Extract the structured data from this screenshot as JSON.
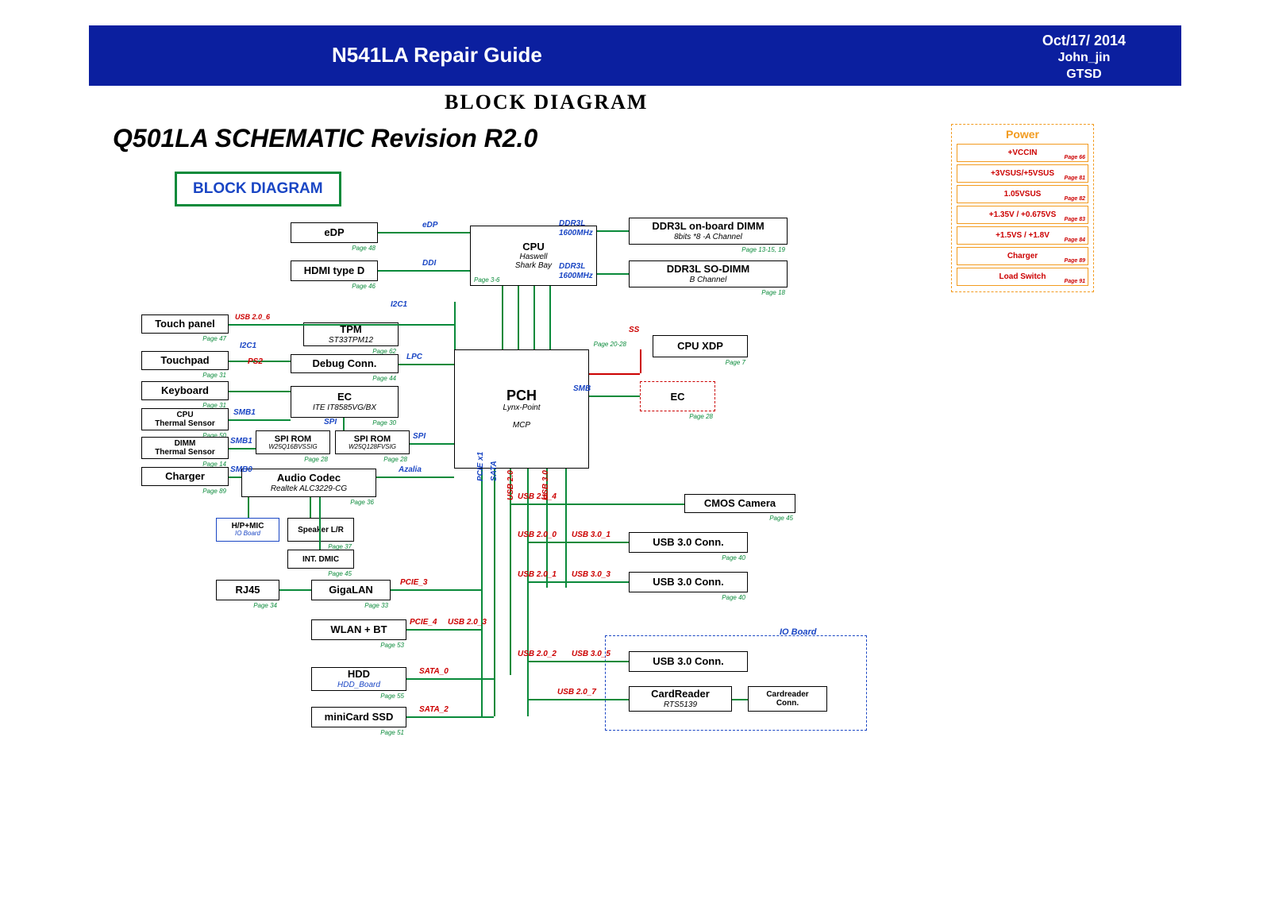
{
  "header": {
    "title": "N541LA Repair Guide",
    "date": "Oct/17/ 2014",
    "author": "John_jin",
    "org": "GTSD"
  },
  "section_title": "BLOCK DIAGRAM",
  "schematic_title": "Q501LA SCHEMATIC Revision R2.0",
  "bd_label": "BLOCK DIAGRAM",
  "blocks": {
    "edp": {
      "t": "eDP",
      "p": "Page 48"
    },
    "hdmi": {
      "t": "HDMI type D",
      "p": "Page 46"
    },
    "cpu": {
      "t": "CPU",
      "s": "Haswell\nShark Bay",
      "p": "Page 3-6"
    },
    "ddr_on": {
      "t": "DDR3L on-board DIMM",
      "s": "8bits *8 -A Channel",
      "p": "Page 13-15, 19"
    },
    "ddr_so": {
      "t": "DDR3L SO-DIMM",
      "s": "B Channel",
      "p": "Page 18"
    },
    "touchpanel": {
      "t": "Touch panel",
      "p": "Page 47"
    },
    "tpm": {
      "t": "TPM",
      "s": "ST33TPM12",
      "p": "Page 62"
    },
    "touchpad": {
      "t": "Touchpad",
      "p": "Page 31"
    },
    "debug": {
      "t": "Debug Conn.",
      "p": "Page 44"
    },
    "keyboard": {
      "t": "Keyboard",
      "p": "Page 31"
    },
    "cputherm": {
      "t": "CPU\nThermal Sensor",
      "p": "Page 50"
    },
    "dimmtherm": {
      "t": "DIMM\nThermal Sensor",
      "p": "Page 14"
    },
    "charger": {
      "t": "Charger",
      "p": "Page 89"
    },
    "ec": {
      "t": "EC",
      "s": "ITE IT8585VG/BX",
      "p": "Page 30"
    },
    "spirom1": {
      "t": "SPI ROM",
      "s": "W25Q16BVSSIG",
      "p": "Page 28"
    },
    "spirom2": {
      "t": "SPI ROM",
      "s": "W25Q128FVSIG",
      "p": "Page 28"
    },
    "audio": {
      "t": "Audio Codec",
      "s": "Realtek ALC3229-CG",
      "p": "Page 36"
    },
    "pch": {
      "t": "PCH",
      "s": "Lynx-Point\n\nMCP",
      "p": "Page 20-28"
    },
    "cpuxdp": {
      "t": "CPU XDP",
      "p": "Page 7"
    },
    "ec2": {
      "t": "EC",
      "p": "Page 28"
    },
    "cmos": {
      "t": "CMOS Camera",
      "p": "Page 45"
    },
    "usb1": {
      "t": "USB 3.0 Conn.",
      "p": "Page 40"
    },
    "usb2": {
      "t": "USB 3.0 Conn.",
      "p": "Page 40"
    },
    "usb3": {
      "t": "USB 3.0 Conn."
    },
    "cardreader": {
      "t": "CardReader",
      "s": "RTS5139"
    },
    "cardconn": {
      "t": "Cardreader\nConn."
    },
    "hpmic": {
      "t": "H/P+MIC",
      "s": "IO Board"
    },
    "speaker": {
      "t": "Speaker L/R",
      "p": "Page 37"
    },
    "dmic": {
      "t": "INT. DMIC",
      "p": "Page 45"
    },
    "rj45": {
      "t": "RJ45",
      "p": "Page 34"
    },
    "gigalan": {
      "t": "GigaLAN",
      "p": "Page 33"
    },
    "wlan": {
      "t": "WLAN + BT",
      "p": "Page 53"
    },
    "hdd": {
      "t": "HDD",
      "s": "HDD_Board",
      "p": "Page 55"
    },
    "ssd": {
      "t": "miniCard SSD",
      "p": "Page 51"
    }
  },
  "bus_labels": {
    "edp_l": "eDP",
    "ddi_l": "DDI",
    "i2c1_l": "I2C1",
    "i2c1_l2": "I2C1",
    "ps2_l": "PS2",
    "smb1_l": "SMB1",
    "smb1_l2": "SMB1",
    "smb0_l": "SMB0",
    "spi_l": "SPI",
    "spi_l2": "SPI",
    "lpc_l": "LPC",
    "azalia_l": "Azalia",
    "pcie3_l": "PCIE_3",
    "pcie4_l": "PCIE_4",
    "sata0_l": "SATA_0",
    "sata2_l": "SATA_2",
    "smb_l": "SMB",
    "ss_l": "SS",
    "ddr1_l": "DDR3L",
    "ddr1_s": "1600MHz",
    "ddr2_l": "DDR3L",
    "ddr2_s": "1600MHz",
    "usb203_l": "USB 2.0_3",
    "usb204_l": "USB 2.0_4",
    "usb200_l": "USB 2.0_0",
    "usb301_l": "USB 3.0_1",
    "usb201_l": "USB 2.0_1",
    "usb303_l": "USB 3.0_3",
    "usb202_l": "USB 2.0_2",
    "usb305_l": "USB 3.0_5",
    "usb207_l": "USB 2.0_7",
    "pciex1_l": "PCIE x1",
    "sata_l": "SATA",
    "usb20v_l": "USB 2.0",
    "usb30v_l": "USB 3.0"
  },
  "io_label": "IO Board",
  "power": {
    "title": "Power",
    "rows": [
      {
        "t": "+VCCIN",
        "p": "Page 66"
      },
      {
        "t": "+3VSUS/+5VSUS",
        "p": "Page 81"
      },
      {
        "t": "1.05VSUS",
        "p": "Page 82"
      },
      {
        "t": "+1.35V / +0.675VS",
        "p": "Page 83"
      },
      {
        "t": "+1.5VS / +1.8V",
        "p": "Page 84"
      },
      {
        "t": "Charger",
        "p": "Page 89"
      },
      {
        "t": "Load Switch",
        "p": "Page 91"
      }
    ]
  }
}
